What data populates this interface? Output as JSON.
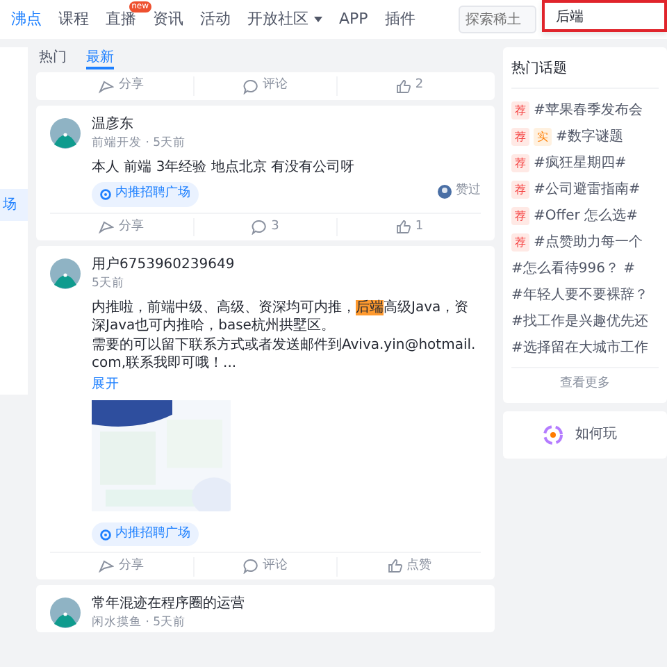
{
  "nav": {
    "items": [
      {
        "label": "沸点",
        "selected": true
      },
      {
        "label": "课程",
        "selected": false
      },
      {
        "label": "直播",
        "selected": false,
        "badge": "new"
      },
      {
        "label": "资讯",
        "selected": false
      },
      {
        "label": "活动",
        "selected": false
      },
      {
        "label": "开放社区",
        "selected": false,
        "dropdown": true
      },
      {
        "label": "APP",
        "selected": false
      },
      {
        "label": "插件",
        "selected": false
      }
    ],
    "search": {
      "placeholder": "探索稀土"
    },
    "suggestions": [
      "后端"
    ]
  },
  "sidebar": {
    "items": [
      {
        "label": "场",
        "selected": true
      }
    ]
  },
  "feed": {
    "tabs": [
      {
        "label": "热门",
        "selected": false
      },
      {
        "label": "最新",
        "selected": true
      }
    ],
    "posts": [
      {
        "actions": [
          {
            "kind": "share",
            "label": "分享"
          },
          {
            "kind": "comment",
            "label": "评论"
          },
          {
            "kind": "like",
            "label": "2"
          }
        ]
      },
      {
        "author": "温彦东",
        "meta": "前端开发 · 5天前",
        "paragraphs": [
          [
            {
              "text": "本人 前端 3年经验 地点北京 有没有公司呀",
              "highlight": false
            }
          ]
        ],
        "tag": "内推招聘广场",
        "liked_by": "赞过",
        "actions": [
          {
            "kind": "share",
            "label": "分享"
          },
          {
            "kind": "comment",
            "label": "3"
          },
          {
            "kind": "like",
            "label": "1"
          }
        ]
      },
      {
        "author": "用户6753960239649",
        "meta": "5天前",
        "paragraphs": [
          [
            {
              "text": "内推啦，前端中级、高级、资深均可内推，",
              "highlight": false
            },
            {
              "text": "后端",
              "highlight": true
            },
            {
              "text": "高级Java，资深Java也可内推哈，base杭州拱墅区。",
              "highlight": false
            }
          ],
          [
            {
              "text": "需要的可以留下联系方式或者发送邮件到Aviva.yin@hotmail.com,联系我即可哦！...",
              "highlight": false
            }
          ]
        ],
        "expand": "展开",
        "image": true,
        "tag": "内推招聘广场",
        "actions": [
          {
            "kind": "share",
            "label": "分享"
          },
          {
            "kind": "comment",
            "label": "评论"
          },
          {
            "kind": "like",
            "label": "点赞"
          }
        ]
      },
      {
        "author": "常年混迹在程序圈的运营",
        "meta": "闲水摸鱼 · 5天前"
      }
    ]
  },
  "hot_topics": {
    "title": "热门话题",
    "items": [
      {
        "badges": [
          {
            "kind": "recommend",
            "label": "荐"
          }
        ],
        "text": "#苹果春季发布会"
      },
      {
        "badges": [
          {
            "kind": "recommend",
            "label": "荐"
          },
          {
            "kind": "real",
            "label": "实"
          }
        ],
        "text": "#数字谜题"
      },
      {
        "badges": [
          {
            "kind": "recommend",
            "label": "荐"
          }
        ],
        "text": "#疯狂星期四#"
      },
      {
        "badges": [
          {
            "kind": "recommend",
            "label": "荐"
          }
        ],
        "text": "#公司避雷指南#"
      },
      {
        "badges": [
          {
            "kind": "recommend",
            "label": "荐"
          }
        ],
        "text": "#Offer 怎么选#"
      },
      {
        "badges": [
          {
            "kind": "recommend",
            "label": "荐"
          }
        ],
        "text": "#点赞助力每一个"
      },
      {
        "text": "#怎么看待996？ #"
      },
      {
        "text": "#年轻人要不要裸辞？"
      },
      {
        "text": "#找工作是兴趣优先还"
      },
      {
        "text": "#选择留在大城市工作"
      }
    ],
    "more": "查看更多"
  },
  "promo": {
    "text": "如何玩"
  }
}
